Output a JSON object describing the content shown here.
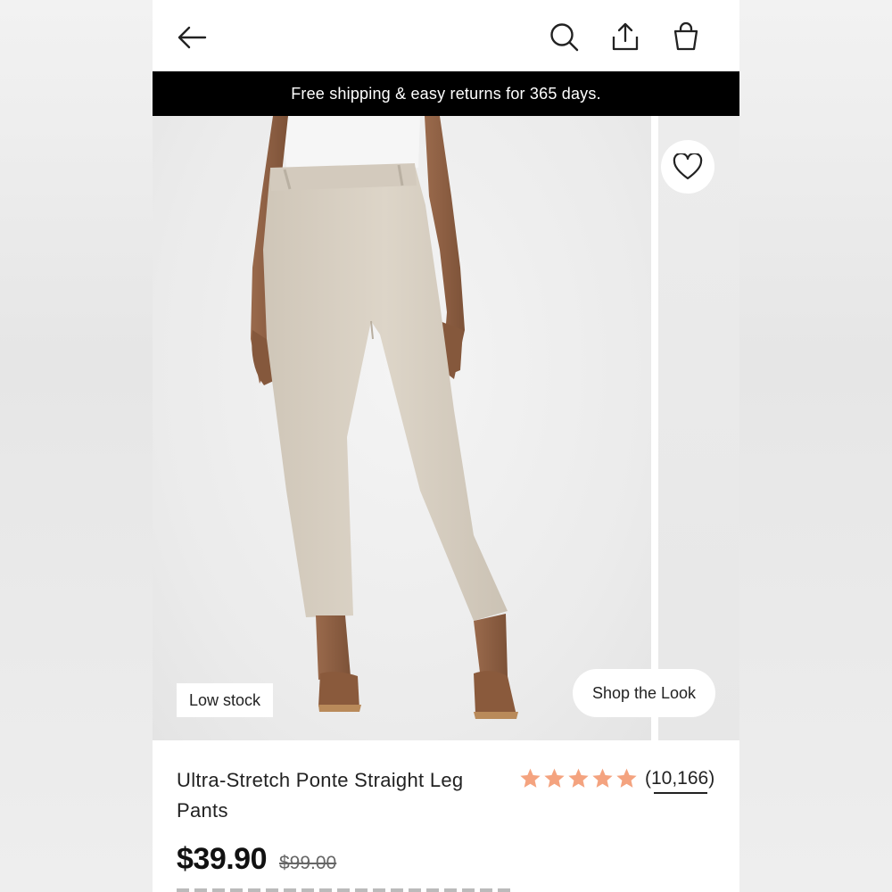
{
  "header": {
    "back_icon": "arrow-left-icon",
    "search_icon": "search-icon",
    "share_icon": "share-icon",
    "bag_icon": "shopping-bag-icon"
  },
  "banner": {
    "text": "Free shipping & easy returns for 365 days."
  },
  "gallery": {
    "low_stock_label": "Low stock",
    "shop_the_look_label": "Shop the Look",
    "favorite_icon": "heart-icon"
  },
  "product": {
    "title": "Ultra-Stretch Ponte Straight Leg Pants",
    "rating_stars": 5,
    "review_count": "(10,166)",
    "price": "$39.90",
    "original_price": "$99.00",
    "star_color": "#f4a37f"
  }
}
